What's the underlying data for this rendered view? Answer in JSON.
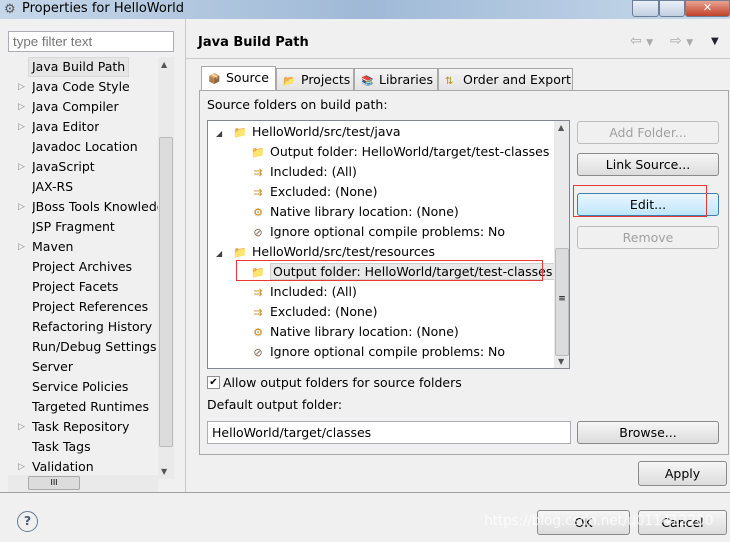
{
  "window": {
    "title": "Properties for HelloWorld"
  },
  "filter": {
    "placeholder": "type filter text"
  },
  "nav": {
    "items": [
      {
        "label": "Java Build Path",
        "expandable": false,
        "selected": true
      },
      {
        "label": "Java Code Style",
        "expandable": true
      },
      {
        "label": "Java Compiler",
        "expandable": true
      },
      {
        "label": "Java Editor",
        "expandable": true
      },
      {
        "label": "Javadoc Location",
        "expandable": false
      },
      {
        "label": "JavaScript",
        "expandable": true
      },
      {
        "label": "JAX-RS",
        "expandable": false
      },
      {
        "label": "JBoss Tools Knowledge",
        "expandable": true
      },
      {
        "label": "JSP Fragment",
        "expandable": false
      },
      {
        "label": "Maven",
        "expandable": true
      },
      {
        "label": "Project Archives",
        "expandable": false
      },
      {
        "label": "Project Facets",
        "expandable": false
      },
      {
        "label": "Project References",
        "expandable": false
      },
      {
        "label": "Refactoring History",
        "expandable": false
      },
      {
        "label": "Run/Debug Settings",
        "expandable": false
      },
      {
        "label": "Server",
        "expandable": false
      },
      {
        "label": "Service Policies",
        "expandable": false
      },
      {
        "label": "Targeted Runtimes",
        "expandable": false
      },
      {
        "label": "Task Repository",
        "expandable": true
      },
      {
        "label": "Task Tags",
        "expandable": false
      },
      {
        "label": "Validation",
        "expandable": true
      }
    ]
  },
  "page": {
    "title": "Java Build Path"
  },
  "tabs": [
    {
      "label": "Source",
      "active": true
    },
    {
      "label": "Projects"
    },
    {
      "label": "Libraries"
    },
    {
      "label": "Order and Export"
    }
  ],
  "source": {
    "label": "Source folders on build path:",
    "tree": [
      {
        "label": "HelloWorld/src/test/java",
        "level": 0,
        "icon": "package-folder-icon"
      },
      {
        "label": "Output folder: HelloWorld/target/test-classes",
        "level": 1,
        "icon": "output-folder-icon"
      },
      {
        "label": "Included: (All)",
        "level": 1,
        "icon": "included-icon"
      },
      {
        "label": "Excluded: (None)",
        "level": 1,
        "icon": "excluded-icon"
      },
      {
        "label": "Native library location: (None)",
        "level": 1,
        "icon": "native-library-icon"
      },
      {
        "label": "Ignore optional compile problems: No",
        "level": 1,
        "icon": "ignore-problems-icon"
      },
      {
        "label": "HelloWorld/src/test/resources",
        "level": 0,
        "icon": "package-folder-icon"
      },
      {
        "label": "Output folder: HelloWorld/target/test-classes",
        "level": 1,
        "icon": "output-folder-icon",
        "selected": true
      },
      {
        "label": "Included: (All)",
        "level": 1,
        "icon": "included-icon"
      },
      {
        "label": "Excluded: (None)",
        "level": 1,
        "icon": "excluded-icon"
      },
      {
        "label": "Native library location: (None)",
        "level": 1,
        "icon": "native-library-icon"
      },
      {
        "label": "Ignore optional compile problems: No",
        "level": 1,
        "icon": "ignore-problems-icon"
      }
    ],
    "buttons": {
      "add_folder": "Add Folder...",
      "link_source": "Link Source...",
      "edit": "Edit...",
      "remove": "Remove"
    },
    "allow_output": {
      "label": "Allow output folders for source folders",
      "checked": true
    },
    "default_output": {
      "label": "Default output folder:",
      "value": "HelloWorld/target/classes",
      "browse": "Browse..."
    }
  },
  "apply": "Apply",
  "ok": "OK",
  "cancel": "Cancel",
  "watermark": "https://blog.csdn.net/u011412200",
  "colors": {
    "highlight": "#e53935",
    "selection": "#e8e8e8"
  }
}
